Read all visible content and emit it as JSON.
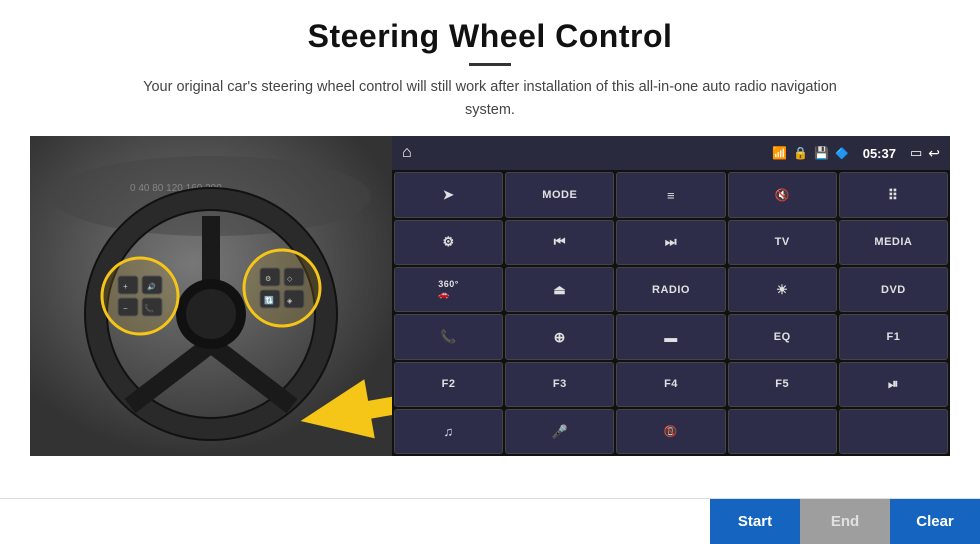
{
  "page": {
    "title": "Steering Wheel Control",
    "subtitle": "Your original car's steering wheel control will still work after installation of this all-in-one auto radio navigation system."
  },
  "status_bar": {
    "time": "05:37",
    "wifi_icon": "📶",
    "lock_icon": "🔒",
    "sd_icon": "💾",
    "bt_icon": "🔵",
    "screen_icon": "⬜",
    "back_icon": "↩"
  },
  "control_buttons": [
    {
      "id": "nav",
      "icon": "➤",
      "label": ""
    },
    {
      "id": "mode",
      "icon": "",
      "label": "MODE"
    },
    {
      "id": "list",
      "icon": "≡",
      "label": ""
    },
    {
      "id": "mute",
      "icon": "🔇",
      "label": ""
    },
    {
      "id": "apps",
      "icon": "⠿",
      "label": ""
    },
    {
      "id": "settings",
      "icon": "⚙",
      "label": ""
    },
    {
      "id": "prev",
      "icon": "⏮",
      "label": ""
    },
    {
      "id": "next",
      "icon": "⏭",
      "label": ""
    },
    {
      "id": "tv",
      "icon": "",
      "label": "TV"
    },
    {
      "id": "media",
      "icon": "",
      "label": "MEDIA"
    },
    {
      "id": "cam360",
      "icon": "360",
      "label": ""
    },
    {
      "id": "eject",
      "icon": "⏏",
      "label": ""
    },
    {
      "id": "radio",
      "icon": "",
      "label": "RADIO"
    },
    {
      "id": "brightness",
      "icon": "☀",
      "label": ""
    },
    {
      "id": "dvd",
      "icon": "",
      "label": "DVD"
    },
    {
      "id": "phone",
      "icon": "📞",
      "label": ""
    },
    {
      "id": "gps",
      "icon": "⊕",
      "label": ""
    },
    {
      "id": "screen_h",
      "icon": "▬",
      "label": ""
    },
    {
      "id": "eq",
      "icon": "",
      "label": "EQ"
    },
    {
      "id": "f1",
      "icon": "",
      "label": "F1"
    },
    {
      "id": "f2",
      "icon": "",
      "label": "F2"
    },
    {
      "id": "f3",
      "icon": "",
      "label": "F3"
    },
    {
      "id": "f4",
      "icon": "",
      "label": "F4"
    },
    {
      "id": "f5",
      "icon": "",
      "label": "F5"
    },
    {
      "id": "playpause",
      "icon": "⏯",
      "label": ""
    },
    {
      "id": "music",
      "icon": "♫",
      "label": ""
    },
    {
      "id": "mic",
      "icon": "🎤",
      "label": ""
    },
    {
      "id": "callend",
      "icon": "📵",
      "label": ""
    },
    {
      "id": "empty1",
      "icon": "",
      "label": ""
    },
    {
      "id": "empty2",
      "icon": "",
      "label": ""
    }
  ],
  "action_bar": {
    "start_label": "Start",
    "end_label": "End",
    "clear_label": "Clear"
  }
}
